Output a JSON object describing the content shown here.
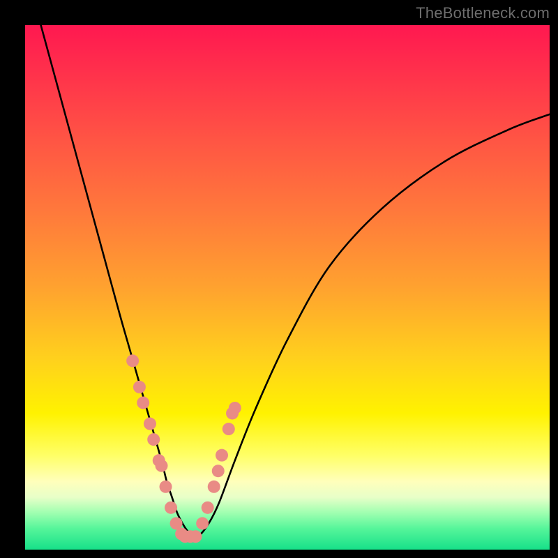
{
  "watermark": "TheBottleneck.com",
  "chart_data": {
    "type": "line",
    "title": "",
    "xlabel": "",
    "ylabel": "",
    "xlim": [
      0,
      100
    ],
    "ylim": [
      0,
      100
    ],
    "grid": false,
    "legend": false,
    "curve": {
      "name": "bottleneck-curve",
      "color": "#000000",
      "x": [
        3,
        6,
        9,
        12,
        15,
        18,
        20,
        22,
        24,
        26,
        27,
        28,
        29,
        30,
        31,
        32,
        33,
        35,
        37,
        40,
        44,
        50,
        58,
        68,
        80,
        92,
        100
      ],
      "y": [
        100,
        89,
        78,
        67,
        56,
        45,
        38,
        31,
        24,
        17,
        13,
        10,
        7,
        5,
        3.5,
        2.5,
        2.5,
        5,
        9,
        17,
        27,
        40,
        54,
        65,
        74,
        80,
        83
      ]
    },
    "markers": {
      "name": "highlight-points",
      "color": "#e98b85",
      "radius": 9,
      "x": [
        20.5,
        21.8,
        22.5,
        23.8,
        24.5,
        25.5,
        26.0,
        26.8,
        27.8,
        28.8,
        29.8,
        30.5,
        31.5,
        32.5,
        33.8,
        34.8,
        36.0,
        36.8,
        37.5,
        38.8,
        39.5,
        40.0
      ],
      "y": [
        36,
        31,
        28,
        24,
        21,
        17,
        16,
        12,
        8,
        5,
        3,
        2.5,
        2.5,
        2.5,
        5,
        8,
        12,
        15,
        18,
        23,
        26,
        27
      ]
    },
    "background_gradient": {
      "type": "vertical",
      "stops": [
        {
          "pos": 0.0,
          "color": "#ff1850"
        },
        {
          "pos": 0.08,
          "color": "#ff2e4c"
        },
        {
          "pos": 0.22,
          "color": "#ff5544"
        },
        {
          "pos": 0.36,
          "color": "#ff7a3b"
        },
        {
          "pos": 0.5,
          "color": "#ffa22f"
        },
        {
          "pos": 0.64,
          "color": "#ffd21c"
        },
        {
          "pos": 0.74,
          "color": "#fff200"
        },
        {
          "pos": 0.82,
          "color": "#ffff66"
        },
        {
          "pos": 0.87,
          "color": "#ffffbb"
        },
        {
          "pos": 0.9,
          "color": "#e8ffc8"
        },
        {
          "pos": 0.93,
          "color": "#9fffb0"
        },
        {
          "pos": 0.96,
          "color": "#55f59a"
        },
        {
          "pos": 1.0,
          "color": "#17e089"
        }
      ]
    }
  }
}
